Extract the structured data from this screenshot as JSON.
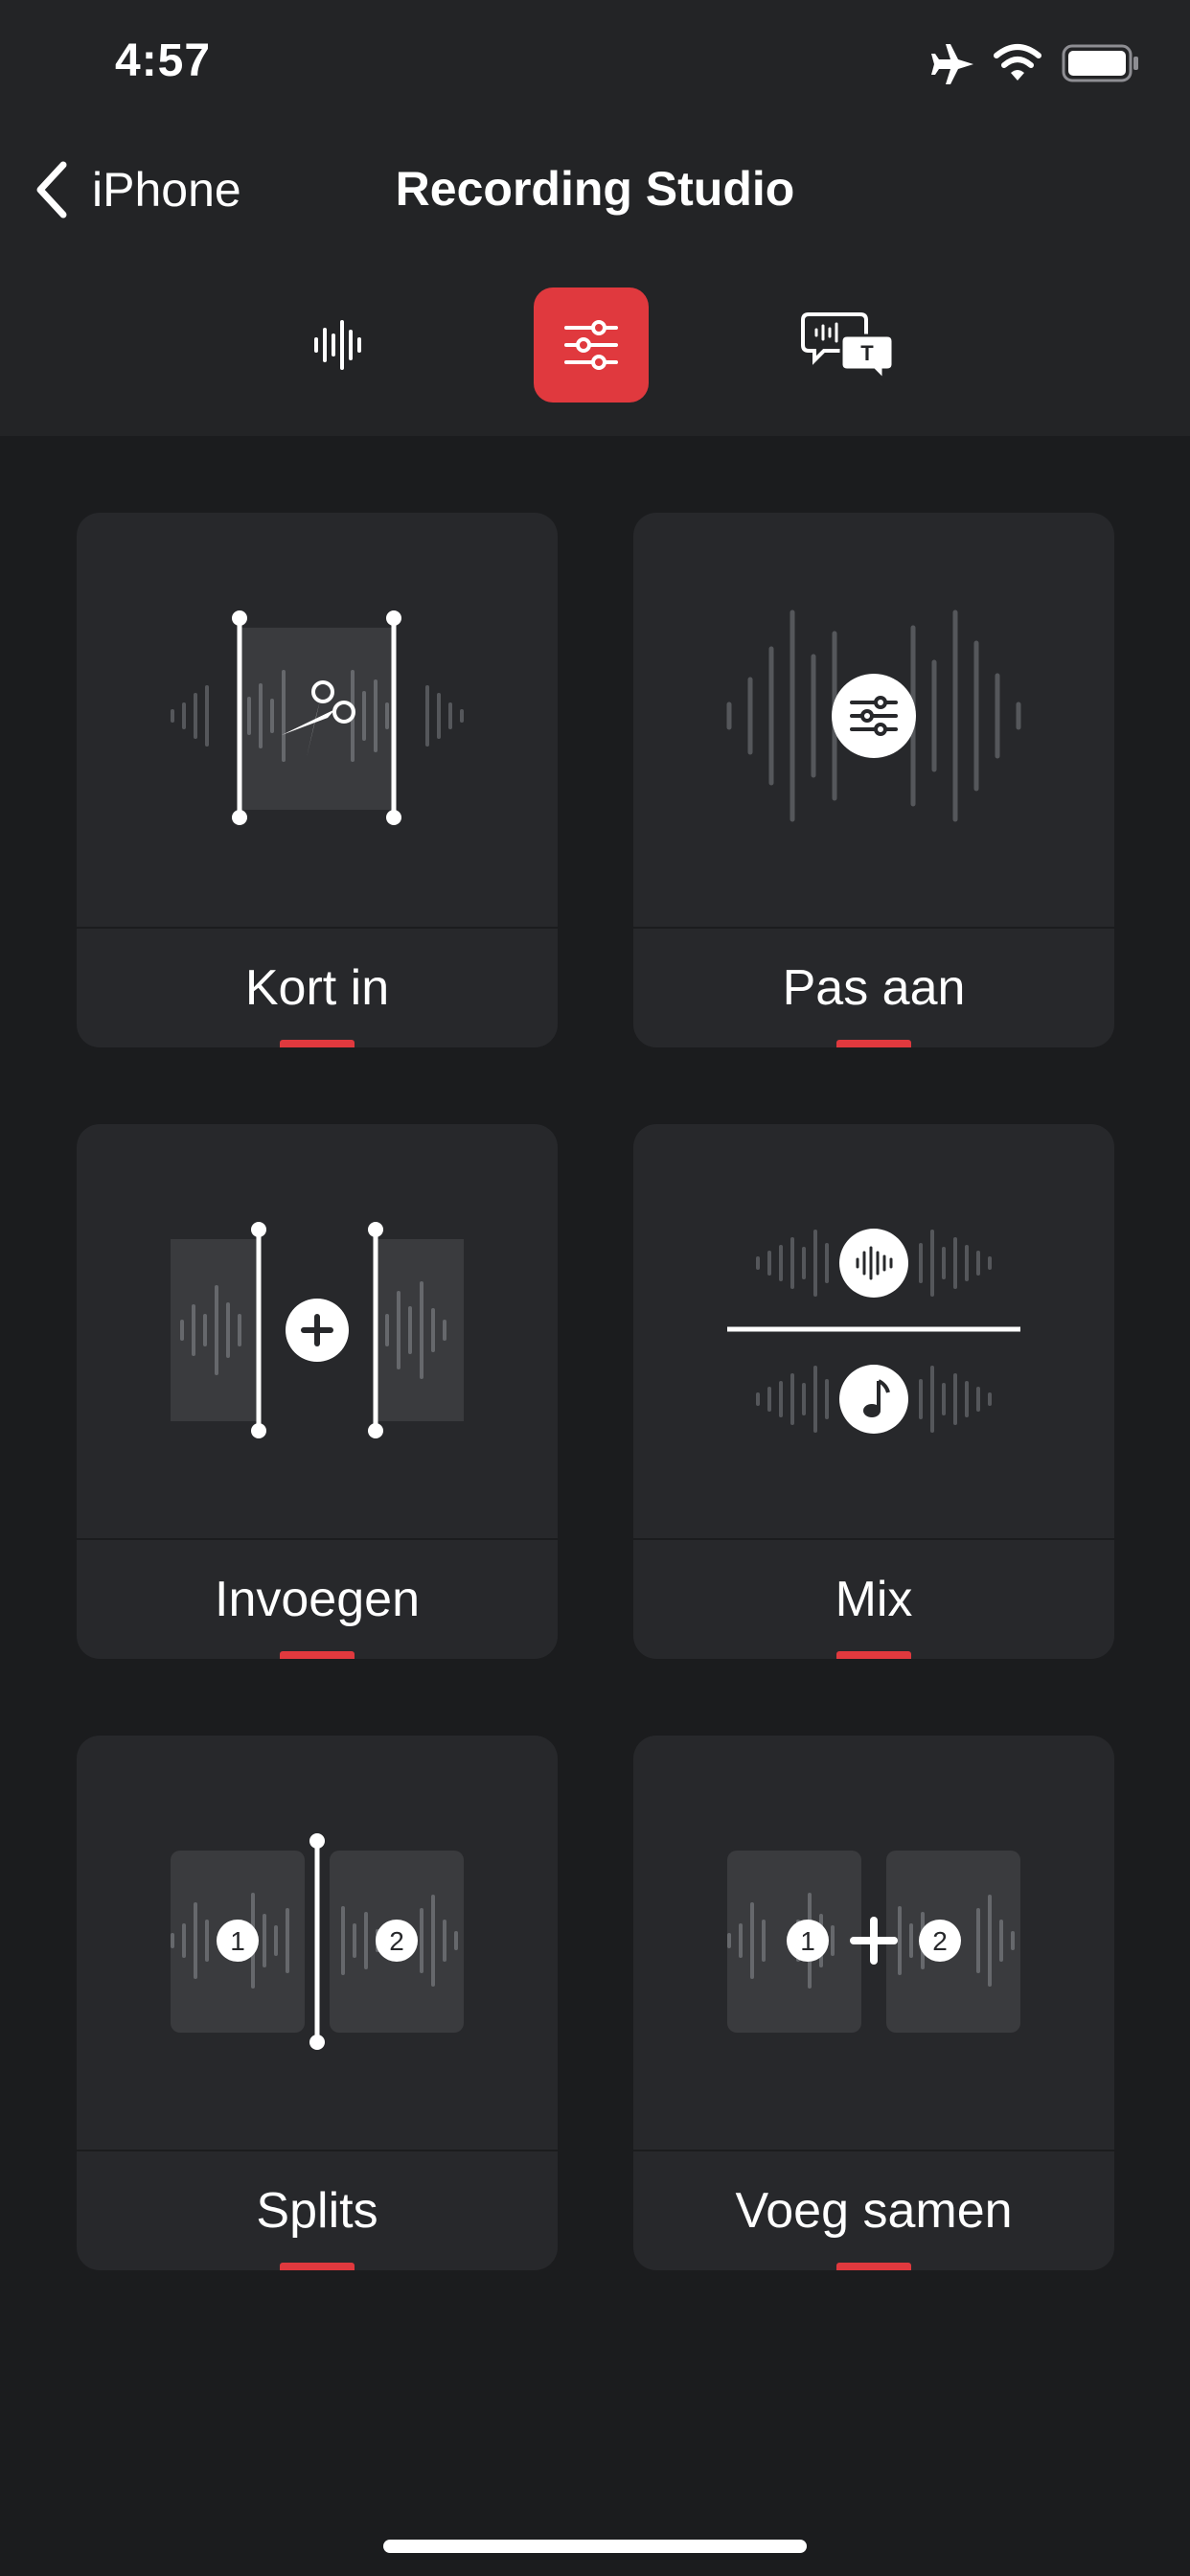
{
  "status": {
    "time": "4:57"
  },
  "nav": {
    "back_label": "iPhone",
    "title": "Recording Studio"
  },
  "tabs": [
    {
      "name": "waveform",
      "active": false
    },
    {
      "name": "edit-sliders",
      "active": true
    },
    {
      "name": "transcript",
      "active": false
    }
  ],
  "tools": [
    {
      "label": "Kort in"
    },
    {
      "label": "Pas aan"
    },
    {
      "label": "Invoegen"
    },
    {
      "label": "Mix"
    },
    {
      "label": "Splits"
    },
    {
      "label": "Voeg samen"
    }
  ],
  "illustration_text": {
    "split_left": "1",
    "split_right": "2",
    "merge_left": "1",
    "merge_right": "2",
    "transcript_badge": "T"
  },
  "colors": {
    "accent": "#e0393e",
    "background": "#1b1c1e",
    "card": "#27282b",
    "header": "#232426"
  }
}
